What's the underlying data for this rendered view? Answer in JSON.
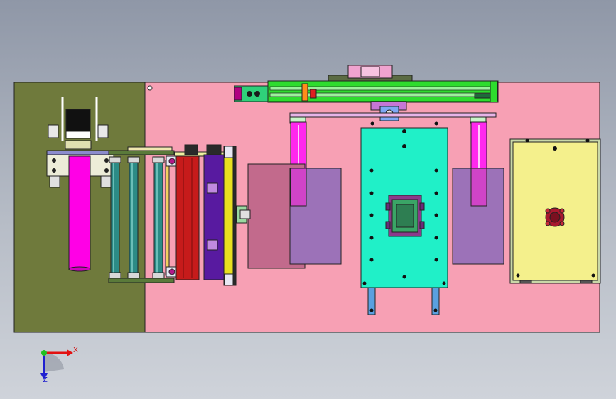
{
  "viewport": {
    "background_top": "#8f97a7",
    "background_bottom": "#cfd3da"
  },
  "colors": {
    "base_plate": "#f7a0b4",
    "left_plate": "#6f7a3c",
    "gantry_beam": "#2edc2e",
    "center_table": "#20f0c8",
    "right_table": "#f4f08c",
    "lilac_pad": "#9c72b8",
    "magenta": "#ff28ee",
    "cylinder": "#ff00e6",
    "roller": "#2c8b86",
    "red_block": "#c61b1b",
    "purple_block": "#581aa0"
  },
  "triad": {
    "x_label": "X",
    "z_label": "Z",
    "x_icon": "x-axis-arrow-icon",
    "z_icon": "z-axis-arrow-icon"
  }
}
